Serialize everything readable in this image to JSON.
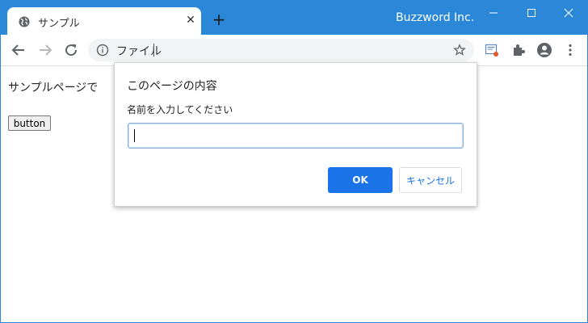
{
  "window": {
    "tab_title": "サンプル",
    "tab_favicon": "globe-icon",
    "profile_name": "Buzzword Inc.",
    "title_bar_color": "#2b88d8",
    "icons": [
      "close-icon",
      "plus-icon",
      "minimize-icon",
      "maximize-icon",
      "window-close-icon"
    ]
  },
  "toolbar": {
    "address_text": "ファイル",
    "icons": [
      "back-arrow-icon",
      "forward-arrow-icon",
      "reload-icon",
      "info-icon",
      "star-icon",
      "reading-list-icon",
      "extensions-icon",
      "profile-avatar-icon",
      "more-menu-icon"
    ]
  },
  "page": {
    "visible_text": "サンプルページで",
    "button_label": "button"
  },
  "dialog": {
    "title": "このページの内容",
    "message": "名前を入力してください",
    "input_value": "",
    "ok_label": "OK",
    "cancel_label": "キャンセル",
    "accent_color": "#1a73e8"
  }
}
